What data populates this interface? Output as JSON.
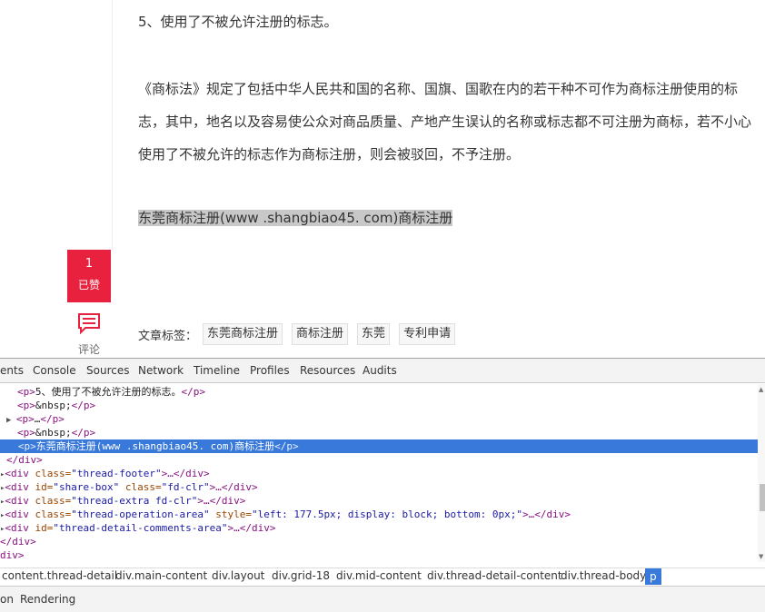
{
  "article": {
    "item5": "5、使用了不被允许注册的标志。",
    "law_paragraph": "《商标法》规定了包括中华人民共和国的名称、国旗、国歌在内的若干种不可作为商标注册使用的标志，其中，地名以及容易使公众对商品质量、产地产生误认的名称或标志都不可注册为商标，若不小心使用了不被允许的标志作为商标注册，则会被驳回，不予注册。",
    "link_text": "东莞商标注册(www .shangbiao45. com)商标注册",
    "like_count": "1",
    "like_label": "已赞",
    "comment_label": "评论",
    "tags_label": "文章标签：",
    "tags": [
      "东莞商标注册",
      "商标注册",
      "东莞",
      "专利申请"
    ]
  },
  "devtools": {
    "tabs": [
      "ents",
      "Console",
      "Sources",
      "Network",
      "Timeline",
      "Profiles",
      "Resources",
      "Audits"
    ],
    "dom_lines": {
      "l1": {
        "t1": "<p>",
        "text": "5、使用了不被允许注册的标志。",
        "t2": "</p>"
      },
      "l2": {
        "t1": "<p>",
        "text": "&nbsp;",
        "t2": "</p>"
      },
      "l3": {
        "t1": "<p>",
        "text": "…",
        "t2": "</p>"
      },
      "l4": {
        "t1": "<p>",
        "text": "&nbsp;",
        "t2": "</p>"
      },
      "l5": {
        "t1": "<p>",
        "text": "东莞商标注册(www .shangbiao45. com)商标注册",
        "t2": "</p>"
      },
      "l6": {
        "t1": "</div>"
      },
      "l7": {
        "t1": "<div",
        "a1": " class=",
        "v1": "\"thread-footer\"",
        "t2": ">…</div>"
      },
      "l8": {
        "t1": "<div",
        "a1": " id=",
        "v1": "\"share-box\"",
        "a2": " class=",
        "v2": "\"fd-clr\"",
        "t2": ">…</div>"
      },
      "l9": {
        "t1": "<div",
        "a1": " class=",
        "v1": "\"thread-extra fd-clr\"",
        "t2": ">…</div>"
      },
      "l10": {
        "t1": "<div",
        "a1": " class=",
        "v1": "\"thread-operation-area\"",
        "a2": " style=",
        "v2": "\"left: 177.5px; display: block; bottom: 0px;\"",
        "t2": ">…</div>"
      },
      "l11": {
        "t1": "<div",
        "a1": " id=",
        "v1": "\"thread-detail-comments-area\"",
        "t2": ">…</div>"
      },
      "l12": {
        "t1": "</div>"
      },
      "l13": {
        "t1": "div>"
      }
    },
    "breadcrumbs": [
      "content.thread-detail",
      "div.main-content",
      "div.layout",
      "div.grid-18",
      "div.mid-content",
      "div.thread-detail-content",
      "div.thread-body",
      "p"
    ],
    "drawer_tabs": [
      "on",
      "Rendering"
    ]
  },
  "colors": {
    "like_red": "#e8213e",
    "selection_blue": "#3879d9",
    "tag_color": "#881280",
    "attr_name_color": "#994500",
    "attr_value_color": "#1a1aa6"
  }
}
